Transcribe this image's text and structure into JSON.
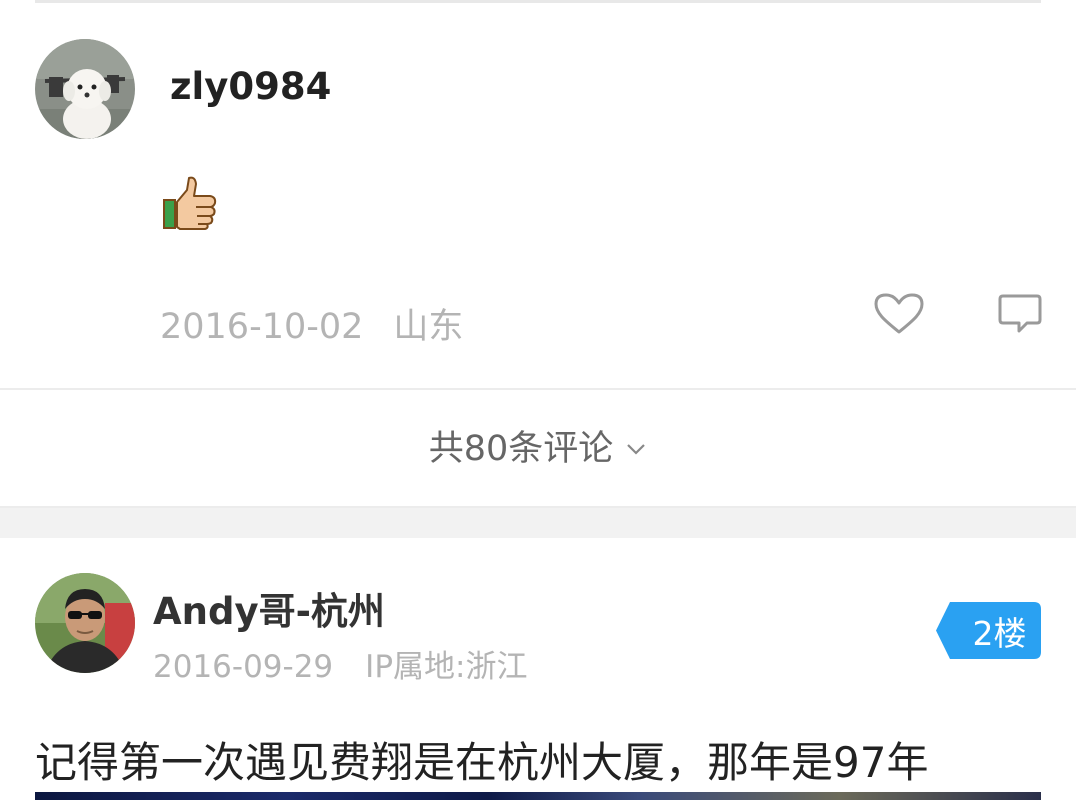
{
  "comment1": {
    "username": "zly0984",
    "content_emoji": "thumbs-up-icon",
    "date": "2016-10-02",
    "region": "山东"
  },
  "more_comments": {
    "label": "共80条评论"
  },
  "comment2": {
    "username": "Andy哥-杭州",
    "date": "2016-09-29",
    "ip_location": "IP属地:浙江",
    "floor": "2楼",
    "text": "记得第一次遇见费翔是在杭州大厦，那年是97年"
  },
  "colors": {
    "badge_blue": "#2aa1f2",
    "meta_gray": "#b4b4b4",
    "divider": "#ececec",
    "band": "#f2f2f2"
  }
}
